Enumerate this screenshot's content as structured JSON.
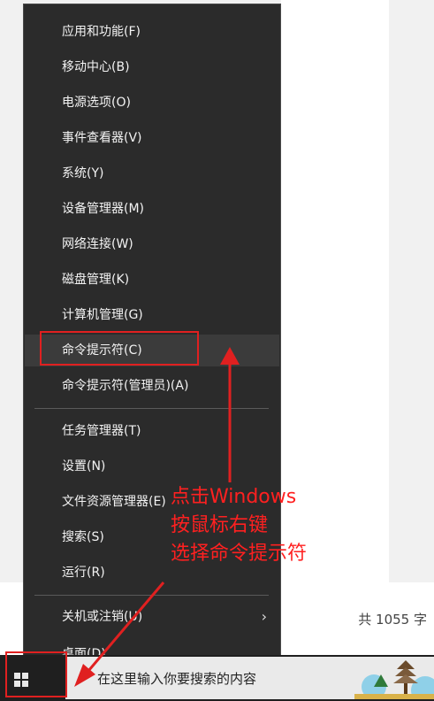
{
  "menu": {
    "items": [
      {
        "label": "应用和功能(F)"
      },
      {
        "label": "移动中心(B)"
      },
      {
        "label": "电源选项(O)"
      },
      {
        "label": "事件查看器(V)"
      },
      {
        "label": "系统(Y)"
      },
      {
        "label": "设备管理器(M)"
      },
      {
        "label": "网络连接(W)"
      },
      {
        "label": "磁盘管理(K)"
      },
      {
        "label": "计算机管理(G)"
      },
      {
        "label": "命令提示符(C)"
      },
      {
        "label": "命令提示符(管理员)(A)"
      },
      {
        "label": "任务管理器(T)"
      },
      {
        "label": "设置(N)"
      },
      {
        "label": "文件资源管理器(E)"
      },
      {
        "label": "搜索(S)"
      },
      {
        "label": "运行(R)"
      },
      {
        "label": "关机或注销(U)"
      },
      {
        "label": "桌面(D)"
      }
    ]
  },
  "page": {
    "word_count": "共 1055 字"
  },
  "taskbar": {
    "search_placeholder": "在这里输入你要搜索的内容"
  },
  "annotation": {
    "lines": [
      "点击Windows",
      "按鼠标右键",
      "选择命令提示符"
    ],
    "color": "#ff2020"
  }
}
